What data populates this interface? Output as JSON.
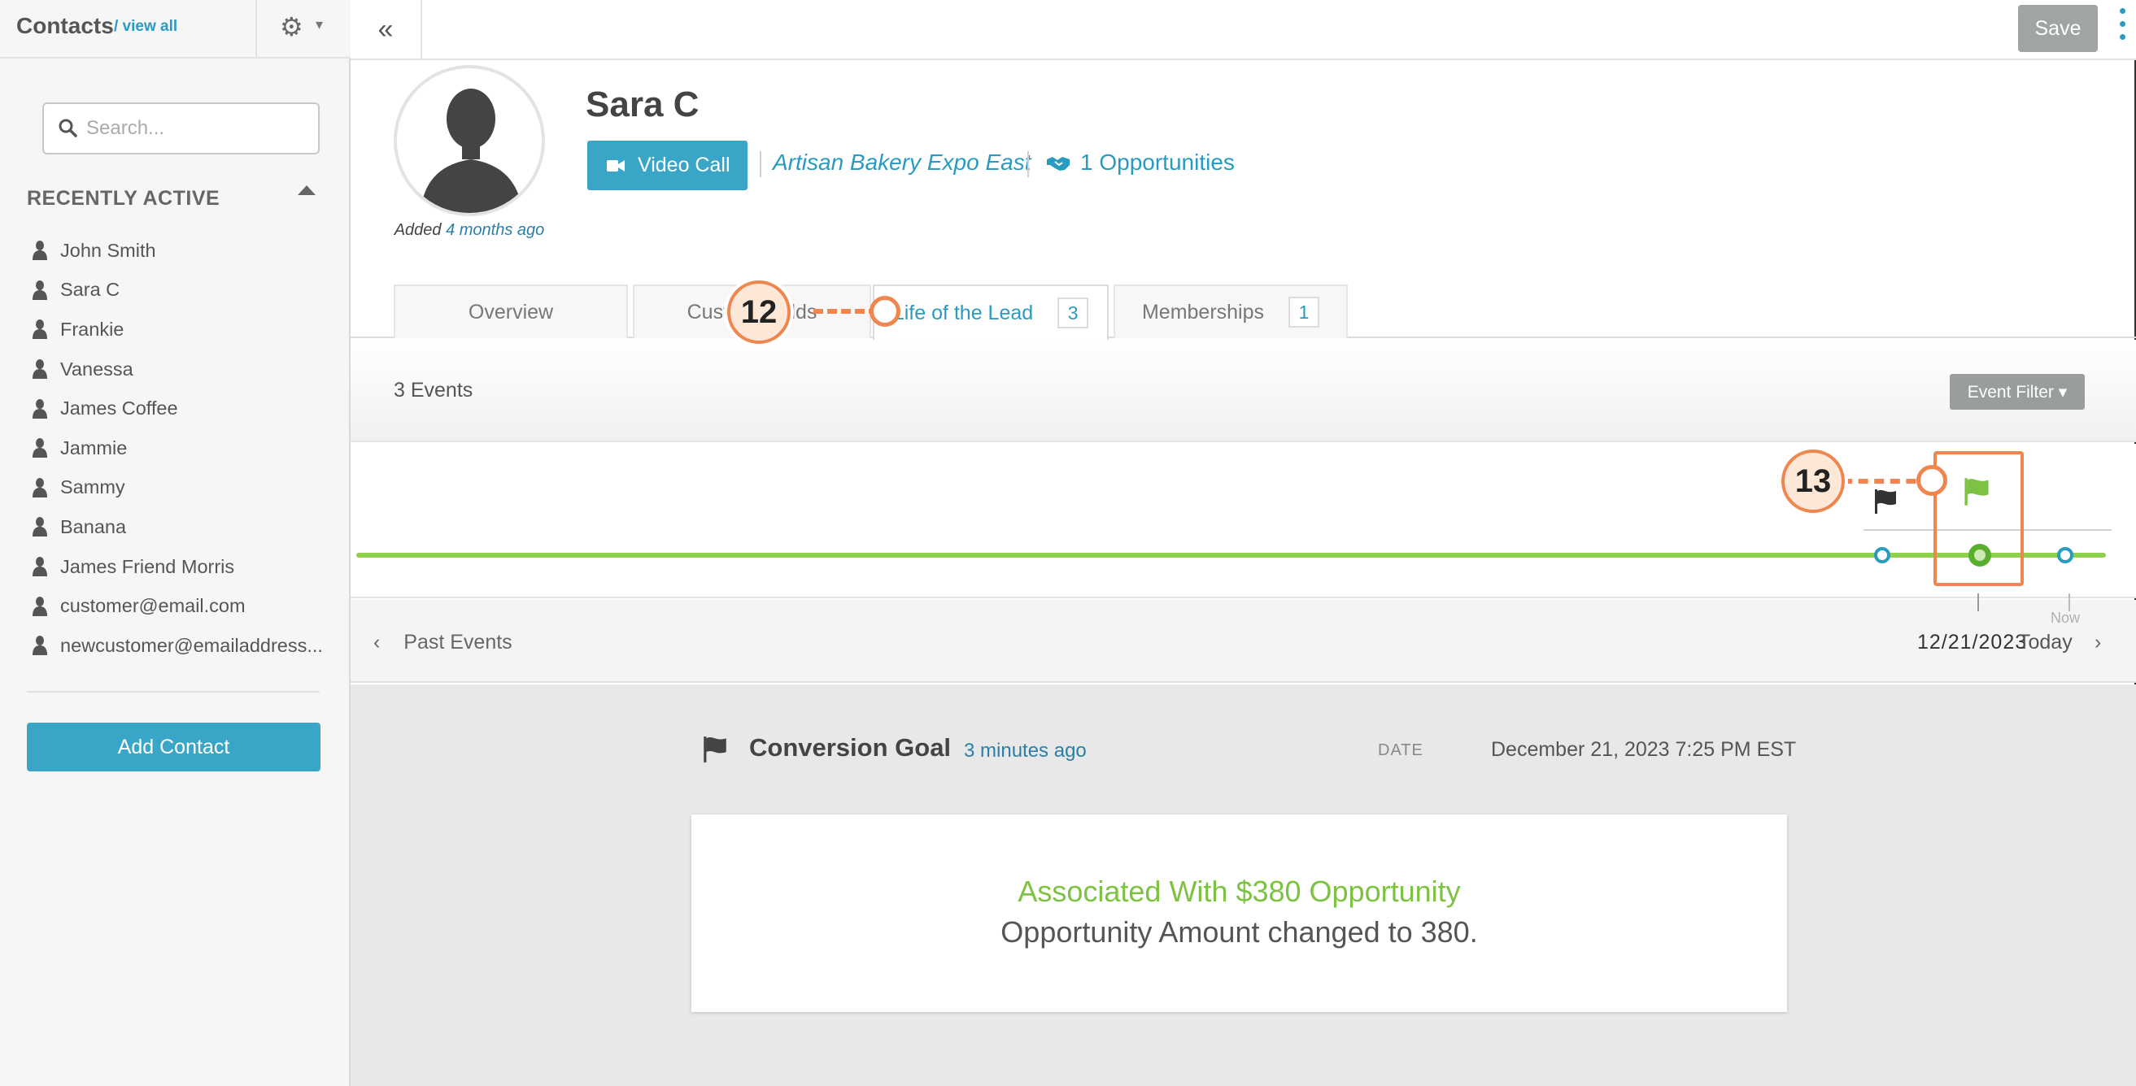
{
  "sidebar": {
    "title": "Contacts",
    "view_all": "/ view all",
    "search_placeholder": "Search...",
    "recently_active_title": "RECENTLY ACTIVE",
    "contacts": [
      "John Smith",
      "Sara C",
      "Frankie",
      "Vanessa",
      "James Coffee",
      "Jammie",
      "Sammy",
      "Banana",
      "James Friend Morris",
      "customer@email.com",
      "newcustomer@emailaddress..."
    ],
    "add_contact_label": "Add Contact"
  },
  "topbar": {
    "collapse_icon": "«",
    "save_label": "Save"
  },
  "profile": {
    "name": "Sara C",
    "added_prefix": "Added",
    "added_ago": "4 months ago",
    "video_call_label": "Video Call",
    "event_link": "Artisan Bakery Expo East",
    "opportunities_link": "1 Opportunities"
  },
  "tabs": [
    {
      "label": "Overview"
    },
    {
      "label": "Custom Fields"
    },
    {
      "label": "Life of the Lead",
      "badge": "3"
    },
    {
      "label": "Memberships",
      "badge": "1"
    }
  ],
  "events": {
    "count_label": "3 Events",
    "filter_label": "Event Filter ▾",
    "past_events_label": "Past Events",
    "date_tick": "12/21/2023",
    "now_label": "Now",
    "today_label": "Today"
  },
  "event_detail": {
    "title": "Conversion Goal",
    "ago": "3 minutes ago",
    "date_label": "DATE",
    "date_value": "December 21, 2023 7:25 PM EST",
    "associated": "Associated With $380 Opportunity",
    "changed": "Opportunity Amount changed to 380."
  },
  "callouts": {
    "tab_callout": "12",
    "timeline_callout": "13"
  },
  "colors": {
    "accent": "#3aa6c7",
    "link": "#2a9bc0",
    "green": "#7dc242",
    "callout": "#f0864f"
  }
}
